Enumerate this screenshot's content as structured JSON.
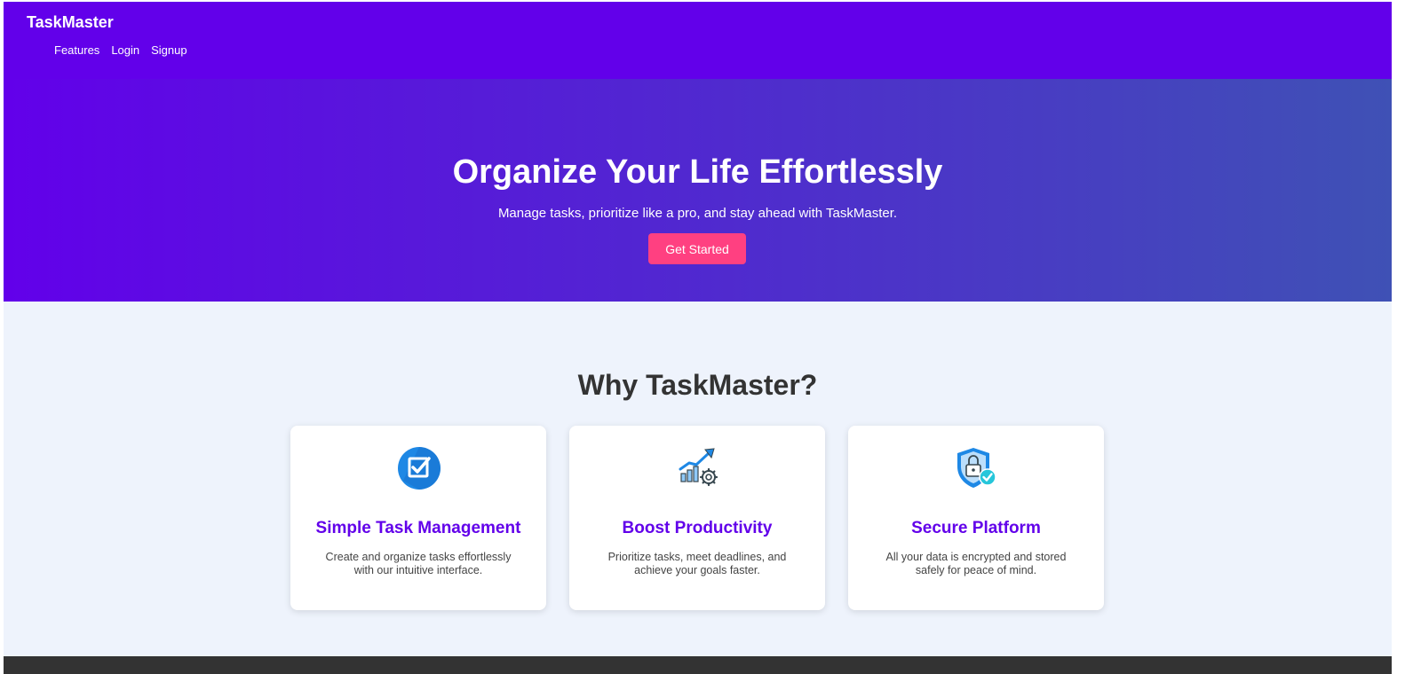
{
  "navbar": {
    "brand": "TaskMaster",
    "links": [
      "Features",
      "Login",
      "Signup"
    ]
  },
  "hero": {
    "title": "Organize Your Life Effortlessly",
    "subtitle": "Manage tasks, prioritize like a pro, and stay ahead with TaskMaster.",
    "cta_label": "Get Started"
  },
  "features": {
    "title": "Why TaskMaster?",
    "cards": [
      {
        "icon": "checkbox-icon",
        "title": "Simple Task Management",
        "text": "Create and organize tasks effortlessly with our intuitive interface."
      },
      {
        "icon": "productivity-chart-icon",
        "title": "Boost Productivity",
        "text": "Prioritize tasks, meet deadlines, and achieve your goals faster."
      },
      {
        "icon": "shield-lock-icon",
        "title": "Secure Platform",
        "text": "All your data is encrypted and stored safely for peace of mind."
      }
    ]
  },
  "colors": {
    "primary": "#6200ea",
    "gradient_end": "#3f51b5",
    "accent": "#ff4081",
    "background": "#eef3fc",
    "footer": "#333333"
  }
}
